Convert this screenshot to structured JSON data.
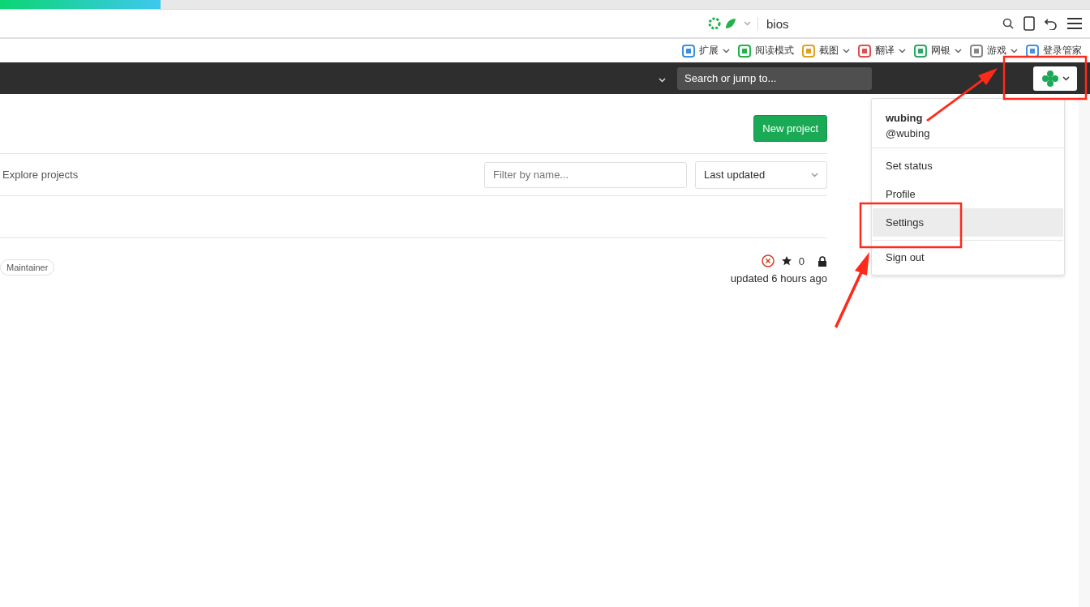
{
  "browser": {
    "address": "bios",
    "bookmarks": [
      {
        "label": "扩展",
        "menu": true,
        "color": "#3b8fe0"
      },
      {
        "label": "阅读模式",
        "menu": false,
        "color": "#22b14c"
      },
      {
        "label": "截图",
        "menu": true,
        "color": "#e0a020"
      },
      {
        "label": "翻译",
        "menu": true,
        "color": "#e05050"
      },
      {
        "label": "网银",
        "menu": true,
        "color": "#2aa866"
      },
      {
        "label": "游戏",
        "menu": true,
        "color": "#888888"
      },
      {
        "label": "登录管家",
        "menu": false,
        "color": "#4a90e2"
      }
    ]
  },
  "navbar": {
    "search": {
      "placeholder": "Search or jump to..."
    }
  },
  "page": {
    "new_project": "New project",
    "explore": "Explore projects",
    "filter": {
      "placeholder": "Filter by name..."
    },
    "sort": "Last updated",
    "project": {
      "role": "Maintainer",
      "stars": "0",
      "updated": "updated 6 hours ago"
    }
  },
  "user_menu": {
    "name": "wubing",
    "handle": "@wubing",
    "items": [
      {
        "label": "Set status",
        "selected": false,
        "separated": false
      },
      {
        "label": "Profile",
        "selected": false,
        "separated": false
      },
      {
        "label": "Settings",
        "selected": true,
        "separated": false
      },
      {
        "label": "Sign out",
        "selected": false,
        "separated": true
      }
    ]
  }
}
